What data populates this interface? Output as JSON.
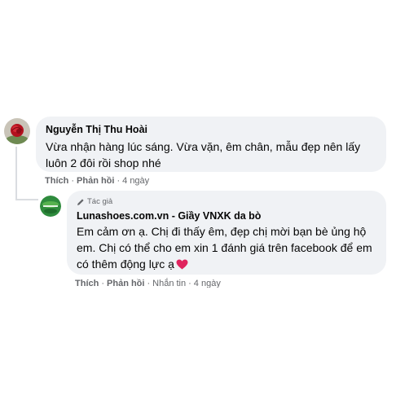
{
  "comments": [
    {
      "author": "Nguyễn Thị Thu Hoài",
      "text": "Vừa nhận hàng lúc sáng. Vừa vặn, êm chân, mẫu đẹp nên lấy luôn 2 đôi rồi shop nhé",
      "actions": {
        "like": "Thích",
        "reply": "Phản hồi",
        "separator": "·",
        "time": "4 ngày"
      }
    },
    {
      "badge": "Tác giả",
      "author": "Lunashoes.com.vn - Giầy VNXK da bò",
      "text": "Em cảm ơn ạ. Chị đi thấy êm, đẹp chị mời bạn bè ủng hộ em. Chị có thể cho em xin 1 đánh giá trên facebook để em có thêm động lực ạ",
      "emoji": "red-heart",
      "actions": {
        "like": "Thích",
        "reply": "Phản hồi",
        "message": "Nhắn tin",
        "separator": "·",
        "time": "4 ngày"
      }
    }
  ],
  "colors": {
    "bubble": "#f0f2f5",
    "text": "#050505",
    "meta": "#65676b",
    "heart": "#e0245e",
    "avatar_page": "#2e8b3d"
  }
}
